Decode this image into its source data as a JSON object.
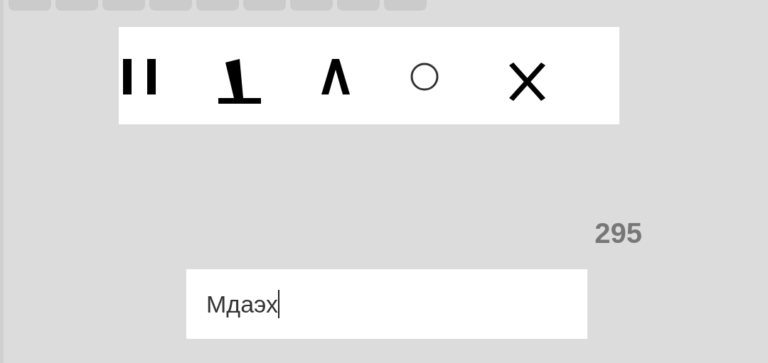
{
  "keys": [
    {
      "kind": "key"
    },
    {
      "kind": "key"
    },
    {
      "kind": "key"
    },
    {
      "kind": "key"
    },
    {
      "kind": "key"
    },
    {
      "kind": "key"
    },
    {
      "kind": "key"
    },
    {
      "kind": "key"
    },
    {
      "kind": "key"
    }
  ],
  "counter": "295",
  "answer_field": {
    "value": "Мдаэх",
    "focused": true
  }
}
